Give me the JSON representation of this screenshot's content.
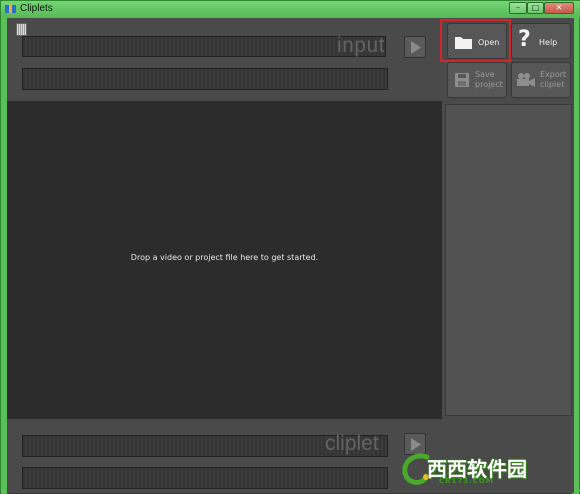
{
  "window": {
    "title": "Cliplets",
    "frame_color": "#5cc05a"
  },
  "titlebar_buttons": {
    "minimize": "–",
    "maximize": "□",
    "close": "✕"
  },
  "input": {
    "watermark": "input"
  },
  "drop_area": {
    "message": "Drop a video or project file here to get started."
  },
  "cliplet": {
    "watermark": "cliplet"
  },
  "toolbar": {
    "open_label": "Open",
    "help_label": "Help",
    "save_label_line1": "Save",
    "save_label_line2": "project",
    "export_label_line1": "Export",
    "export_label_line2": "cliplet",
    "highlight_color": "#d0262a"
  },
  "watermark_logo": {
    "text": "西西软件园",
    "sub": "CR173.COM"
  },
  "icons": {
    "app": "cliplets-app-icon",
    "play": "play-icon",
    "open": "folder-icon",
    "help": "question-mark-icon",
    "save": "floppy-disk-icon",
    "export": "video-camera-icon"
  }
}
